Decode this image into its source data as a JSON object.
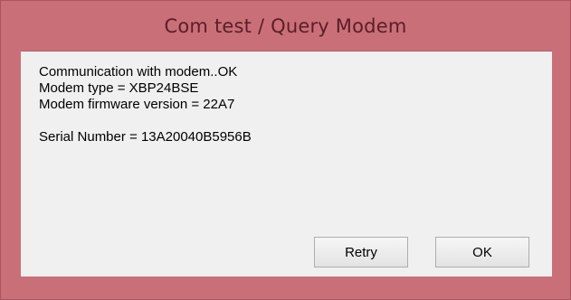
{
  "window": {
    "title": "Com test / Query Modem"
  },
  "messages": {
    "line1": "Communication with modem..OK",
    "line2": "Modem type = XBP24BSE",
    "line3": "Modem firmware version = 22A7",
    "line4": "",
    "line5": "Serial Number = 13A20040B5956B"
  },
  "buttons": {
    "retry_label": "Retry",
    "ok_label": "OK"
  },
  "colors": {
    "title_bar": "#c96f78",
    "title_text": "#5a1e26",
    "client_background": "#f0f0f0"
  }
}
